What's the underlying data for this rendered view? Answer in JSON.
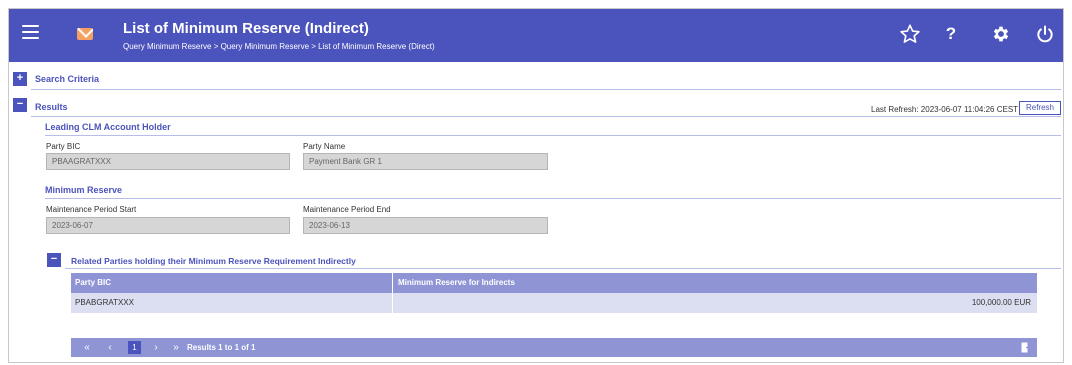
{
  "header": {
    "title": "List of Minimum Reserve (Indirect)",
    "breadcrumb": "Query Minimum Reserve > Query Minimum Reserve > List of Minimum Reserve (Direct)",
    "colors": {
      "bar": "#4b53bc",
      "mail": "#f4a261"
    }
  },
  "search_criteria": {
    "label": "Search Criteria",
    "toggle": "+"
  },
  "results": {
    "label": "Results",
    "toggle": "−",
    "last_refresh": "Last Refresh: 2023-06-07 11:04:26 CEST",
    "refresh_label": "Refresh"
  },
  "leading": {
    "title": "Leading CLM Account Holder",
    "party_bic_label": "Party BIC",
    "party_bic_value": "PBAAGRATXXX",
    "party_name_label": "Party Name",
    "party_name_value": "Payment Bank GR 1"
  },
  "min_reserve": {
    "title": "Minimum Reserve",
    "start_label": "Maintenance Period Start",
    "start_value": "2023-06-07",
    "end_label": "Maintenance Period End",
    "end_value": "2023-06-13"
  },
  "related": {
    "toggle": "−",
    "title": "Related Parties holding their Minimum Reserve Requirement Indirectly",
    "columns": [
      "Party BIC",
      "Minimum Reserve for Indirects"
    ],
    "rows": [
      [
        "PBABGRATXXX",
        "100,000.00 EUR"
      ]
    ]
  },
  "pager": {
    "first": "«",
    "prev": "‹",
    "current": "1",
    "next": "›",
    "last": "»",
    "results_text": "Results 1 to 1 of 1"
  }
}
